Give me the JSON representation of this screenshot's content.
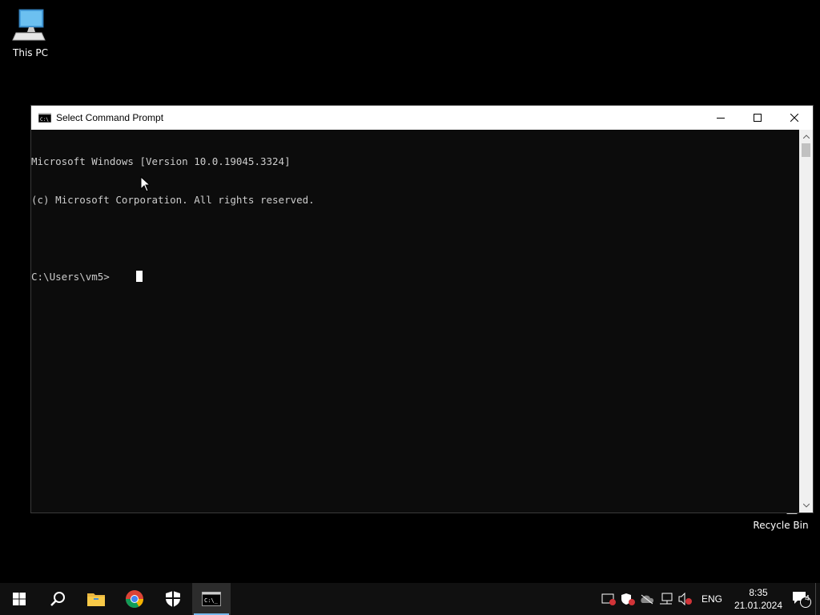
{
  "desktop": {
    "icons": [
      {
        "label": "This PC"
      },
      {
        "label": "Recycle Bin"
      }
    ]
  },
  "window": {
    "title": "Select Command Prompt",
    "icon": "cmd-icon",
    "controls": {
      "minimize": "minimize-icon",
      "maximize": "maximize-icon",
      "close": "close-icon"
    },
    "console_lines": [
      "Microsoft Windows [Version 10.0.19045.3324]",
      "(c) Microsoft Corporation. All rights reserved.",
      "",
      "C:\\Users\\vm5>"
    ],
    "colors": {
      "background": "#0c0c0c",
      "text": "#cccccc"
    }
  },
  "taskbar": {
    "items": [
      {
        "name": "start-button",
        "icon": "windows-logo-icon"
      },
      {
        "name": "search-button",
        "icon": "search-icon"
      },
      {
        "name": "file-explorer",
        "icon": "folder-icon"
      },
      {
        "name": "chrome",
        "icon": "chrome-icon"
      },
      {
        "name": "windows-security",
        "icon": "shield-icon"
      },
      {
        "name": "command-prompt",
        "icon": "cmd-icon",
        "active": true
      }
    ],
    "tray": {
      "icons": [
        "security-warning-icon",
        "defender-icon",
        "onedrive-icon",
        "network-icon",
        "volume-muted-icon"
      ],
      "language": "ENG",
      "time": "8:35",
      "date": "21.01.2024",
      "notifications_count": "4"
    },
    "accent": "#76b9ed"
  }
}
